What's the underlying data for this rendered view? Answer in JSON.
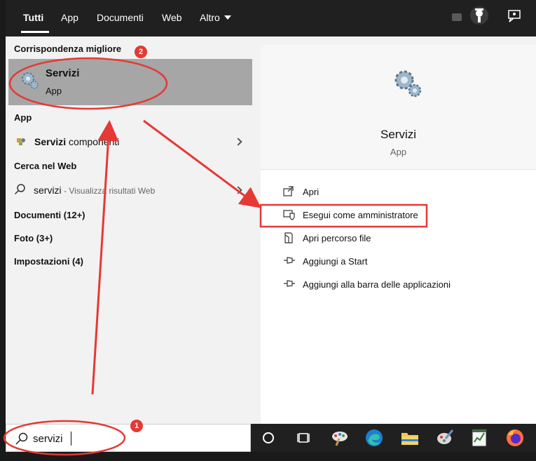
{
  "tabs": [
    {
      "label": "Tutti"
    },
    {
      "label": "App"
    },
    {
      "label": "Documenti"
    },
    {
      "label": "Web"
    },
    {
      "label": "Altro"
    }
  ],
  "left": {
    "best_match_label": "Corrispondenza migliore",
    "best_match": {
      "title": "Servizi",
      "subtitle": "App"
    },
    "app_section_label": "App",
    "app_item": {
      "bold": "Servizi",
      "rest": " componenti"
    },
    "web_section_label": "Cerca nel Web",
    "web_item": {
      "query": "servizi",
      "rest": " - Visualizza risultati Web"
    },
    "documents_label": "Documenti (12+)",
    "photos_label": "Foto (3+)",
    "settings_label": "Impostazioni (4)"
  },
  "right": {
    "app_title": "Servizi",
    "app_type": "App",
    "actions": [
      {
        "label": "Apri",
        "icon": "open-icon"
      },
      {
        "label": "Esegui come amministratore",
        "icon": "shield-icon"
      },
      {
        "label": "Apri percorso file",
        "icon": "file-location-icon"
      },
      {
        "label": "Aggiungi a Start",
        "icon": "pin-icon"
      },
      {
        "label": "Aggiungi alla barra delle applicazioni",
        "icon": "pin-icon"
      }
    ]
  },
  "search": {
    "value": "servizi"
  },
  "annotations": {
    "badge1": "1",
    "badge2": "2",
    "color": "#e53935"
  },
  "taskbar_icons": [
    "cortana-circle-icon",
    "task-view-icon",
    "paint-icon",
    "edge-icon",
    "file-explorer-icon",
    "paint-brush-icon",
    "notepad-chart-icon",
    "firefox-icon"
  ]
}
